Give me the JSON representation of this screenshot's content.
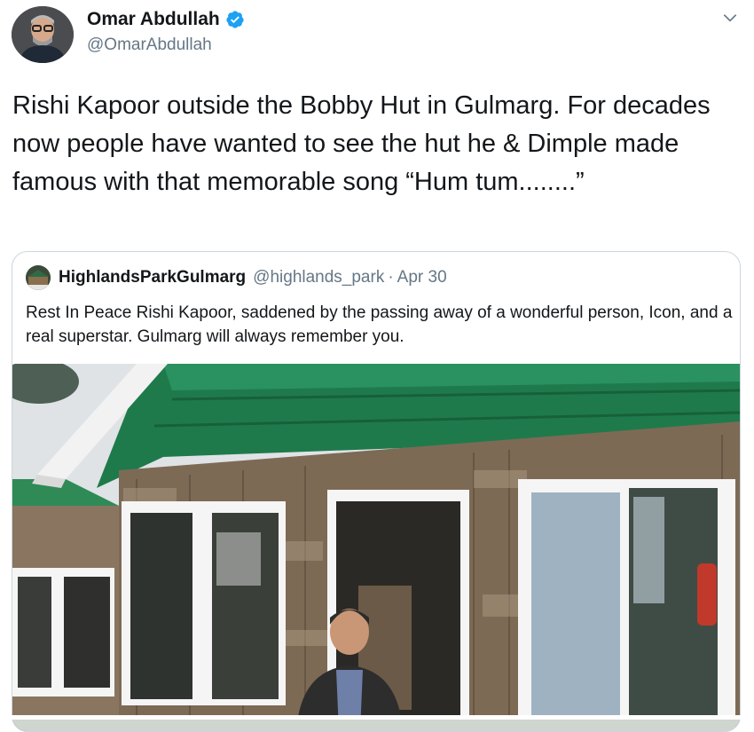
{
  "author": {
    "display_name": "Omar Abdullah",
    "handle": "@OmarAbdullah"
  },
  "tweet": {
    "text": "Rishi Kapoor outside the Bobby Hut in Gulmarg. For decades now people have wanted to see the hut he & Dimple made famous with that memorable song “Hum tum........”"
  },
  "quoted_tweet": {
    "display_name": "HighlandsParkGulmarg",
    "handle": "@highlands_park",
    "separator": "·",
    "date": "Apr 30",
    "text": "Rest In Peace Rishi Kapoor, saddened by the passing away of a wonderful person, Icon, and a real superstar. Gulmarg will always remember you."
  },
  "icons": {
    "verified": "verified-badge-icon",
    "caret": "chevron-down-icon"
  },
  "colors": {
    "primary_text": "#14171a",
    "secondary_text": "#657786",
    "verified_blue": "#1da1f2",
    "border": "#ccd6dd",
    "roof_green": "#1e7a4a"
  }
}
